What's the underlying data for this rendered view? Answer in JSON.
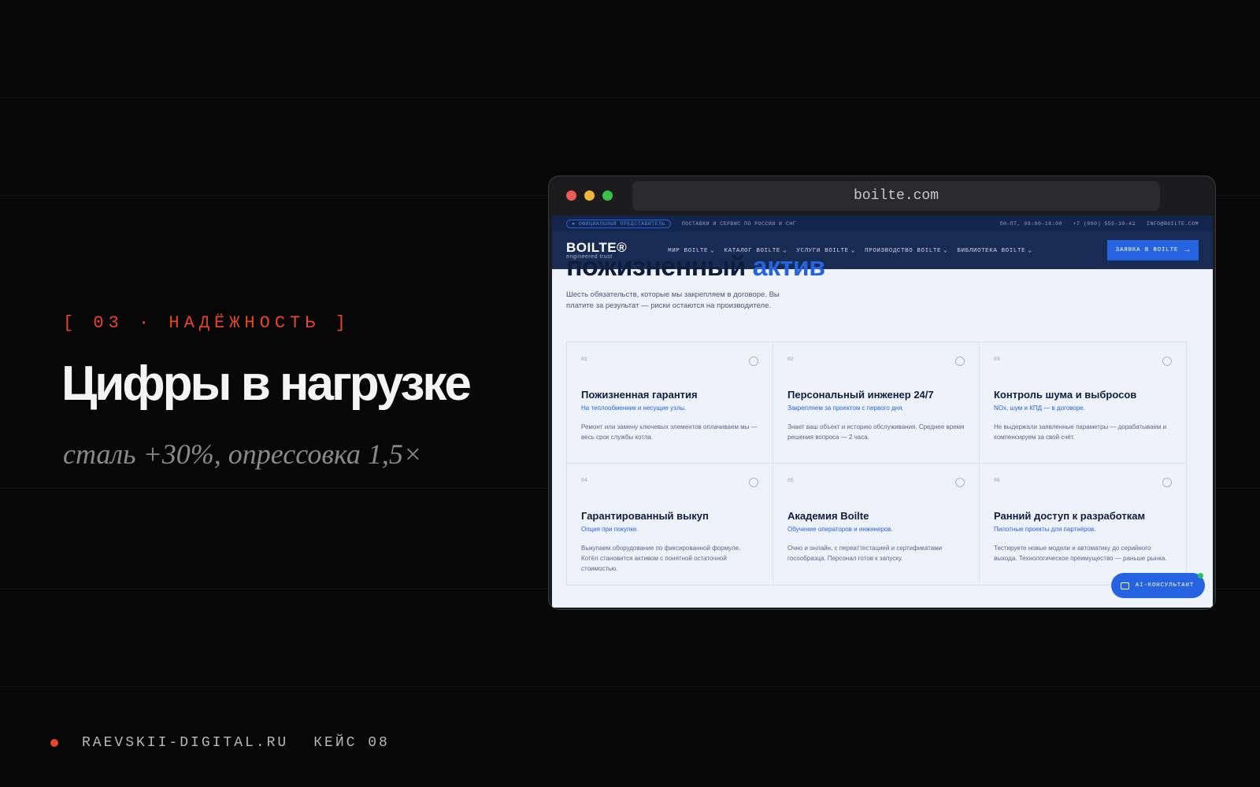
{
  "slide": {
    "eyebrow": "[ 03 · НАДЁЖНОСТЬ ]",
    "headline": "Цифры в нагрузке",
    "subline": "сталь +30%, опрессовка 1,5×",
    "footer_site": "RAEVSKII-DIGITAL.RU",
    "footer_case": "КЕЙС 08",
    "accent_color": "#e8452a"
  },
  "browser": {
    "url": "boilte.com"
  },
  "site": {
    "topbar": {
      "badge": "● ОФИЦИАЛЬНЫЙ ПРЕДСТАВИТЕЛЬ",
      "tagline": "ПОСТАВКИ И СЕРВИС ПО РОССИИ И СНГ",
      "hours": "ПН–ПТ, 09:00–18:00",
      "phone": "+7 (800) 555-39-42",
      "email": "INFO@BOILTE.COM"
    },
    "logo": {
      "name": "BOILTE®",
      "tag": "engineered trust"
    },
    "nav": [
      {
        "label": "МИР BOILTE"
      },
      {
        "label": "КАТАЛОГ BOILTE"
      },
      {
        "label": "УСЛУГИ BOILTE"
      },
      {
        "label": "ПРОИЗВОДСТВО BOILTE"
      },
      {
        "label": "БИБЛИОТЕКА BOILTE"
      }
    ],
    "cta": "ЗАЯВКА В BOILTE",
    "section": {
      "title_main": "пожизненный",
      "title_accent": "актив",
      "description": "Шесть обязательств, которые мы закрепляем в договоре. Вы платите за результат — риски остаются на производителе."
    },
    "cards": [
      {
        "num": "01",
        "title": "Пожизненная гарантия",
        "sub": "На теплообменник и несущие узлы.",
        "body": "Ремонт или замену ключевых элементов оплачиваем мы — весь срок службы котла."
      },
      {
        "num": "02",
        "title": "Персональный инженер 24/7",
        "sub": "Закрепляем за проектом с первого дня.",
        "body": "Знает ваш объект и историю обслуживания. Среднее время решения вопроса — 2 часа."
      },
      {
        "num": "03",
        "title": "Контроль шума и выбросов",
        "sub": "NOx, шум и КПД — в договоре.",
        "body": "Не выдержали заявленные параметры — дорабатываем и компенсируем за свой счёт."
      },
      {
        "num": "04",
        "title": "Гарантированный выкуп",
        "sub": "Опция при покупке.",
        "body": "Выкупаем оборудование по фиксированной формуле. Котёл становится активом с понятной остаточной стоимостью."
      },
      {
        "num": "05",
        "title": "Академия Boilte",
        "sub": "Обучение операторов и инженеров.",
        "body": "Очно и онлайн, с переаттестацией и сертификатами госообразца. Персонал готов к запуску."
      },
      {
        "num": "06",
        "title": "Ранний доступ к разработкам",
        "sub": "Пилотные проекты для партнёров.",
        "body": "Тестируете новые модели и автоматику до серийного выхода. Технологическое преимущество — раньше рынка."
      }
    ],
    "ai_button": "AI-КОНСУЛЬТАНТ"
  }
}
